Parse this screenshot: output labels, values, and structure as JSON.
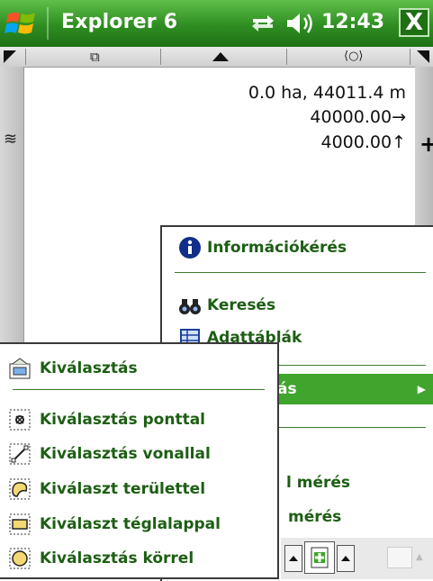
{
  "titlebar": {
    "app_title": "Explorer 6",
    "time": "12:43",
    "close_label": "X"
  },
  "map": {
    "area_distance": "0.0 ha, 44011.4 m",
    "x_coord": "40000.00→",
    "y_coord": "4000.00↑",
    "crosshair": "+"
  },
  "context_menu": {
    "items": [
      {
        "label": "Információkérés",
        "icon": "info-icon"
      },
      {
        "label": "Keresés",
        "icon": "binoculars-icon"
      },
      {
        "label": "Adattáblák",
        "icon": "table-icon"
      },
      {
        "label": "ás",
        "icon": "",
        "highlighted": true
      },
      {
        "label": "l mérés",
        "icon": ""
      },
      {
        "label": "mérés",
        "icon": ""
      }
    ]
  },
  "selection_submenu": {
    "items": [
      {
        "label": "Kiválasztás",
        "icon": "select-icon"
      },
      {
        "label": "Kiválasztás ponttal",
        "icon": "point-select-icon"
      },
      {
        "label": "Kiválasztás vonallal",
        "icon": "line-select-icon"
      },
      {
        "label": "Kiválaszt területtel",
        "icon": "area-select-icon"
      },
      {
        "label": "Kiválaszt téglalappal",
        "icon": "rectangle-select-icon"
      },
      {
        "label": "Kiválasztás körrel",
        "icon": "circle-select-icon"
      }
    ]
  },
  "colors": {
    "titlebar": "#2e8d21",
    "menu_text": "#1d5e14",
    "highlight": "#3fa52c"
  }
}
